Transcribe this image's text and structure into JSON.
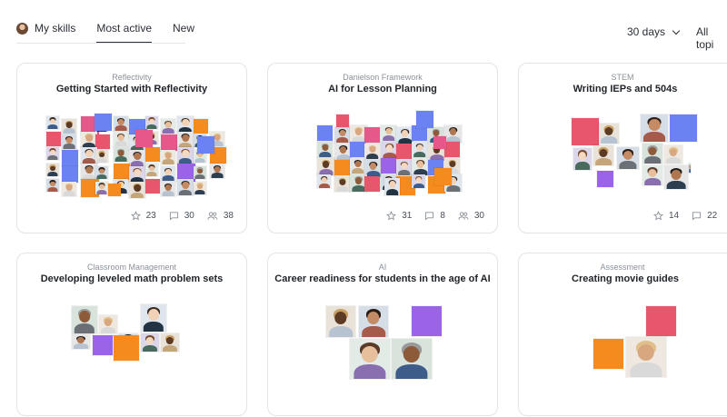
{
  "tabs": [
    {
      "label": "My skills",
      "icon": "user-avatar"
    },
    {
      "label": "Most active"
    },
    {
      "label": "New"
    }
  ],
  "filters": {
    "period": "30 days",
    "topics": "All topi"
  },
  "colors": {
    "red": "#e8566c",
    "blue": "#6b83f2",
    "orange": "#f58a1f",
    "purple": "#9b63e8",
    "pink": "#e6578a",
    "border": "#e2e4e8",
    "muted": "#8b9098"
  },
  "cards": [
    {
      "category": "Reflectivity",
      "title": "Getting Started with Reflectivity",
      "stars": "23",
      "comments": "30",
      "members": "38"
    },
    {
      "category": "Danielson Framework",
      "title": "AI for Lesson Planning",
      "stars": "31",
      "comments": "8",
      "members": "30"
    },
    {
      "category": "STEM",
      "title": "Writing IEPs and 504s",
      "stars": "14",
      "comments": "22",
      "members": ""
    },
    {
      "category": "Classroom Management",
      "title": "Developing leveled math problem sets"
    },
    {
      "category": "AI",
      "title": "Career readiness for students in the age of AI"
    },
    {
      "category": "Assessment",
      "title": "Creating movie guides"
    }
  ]
}
